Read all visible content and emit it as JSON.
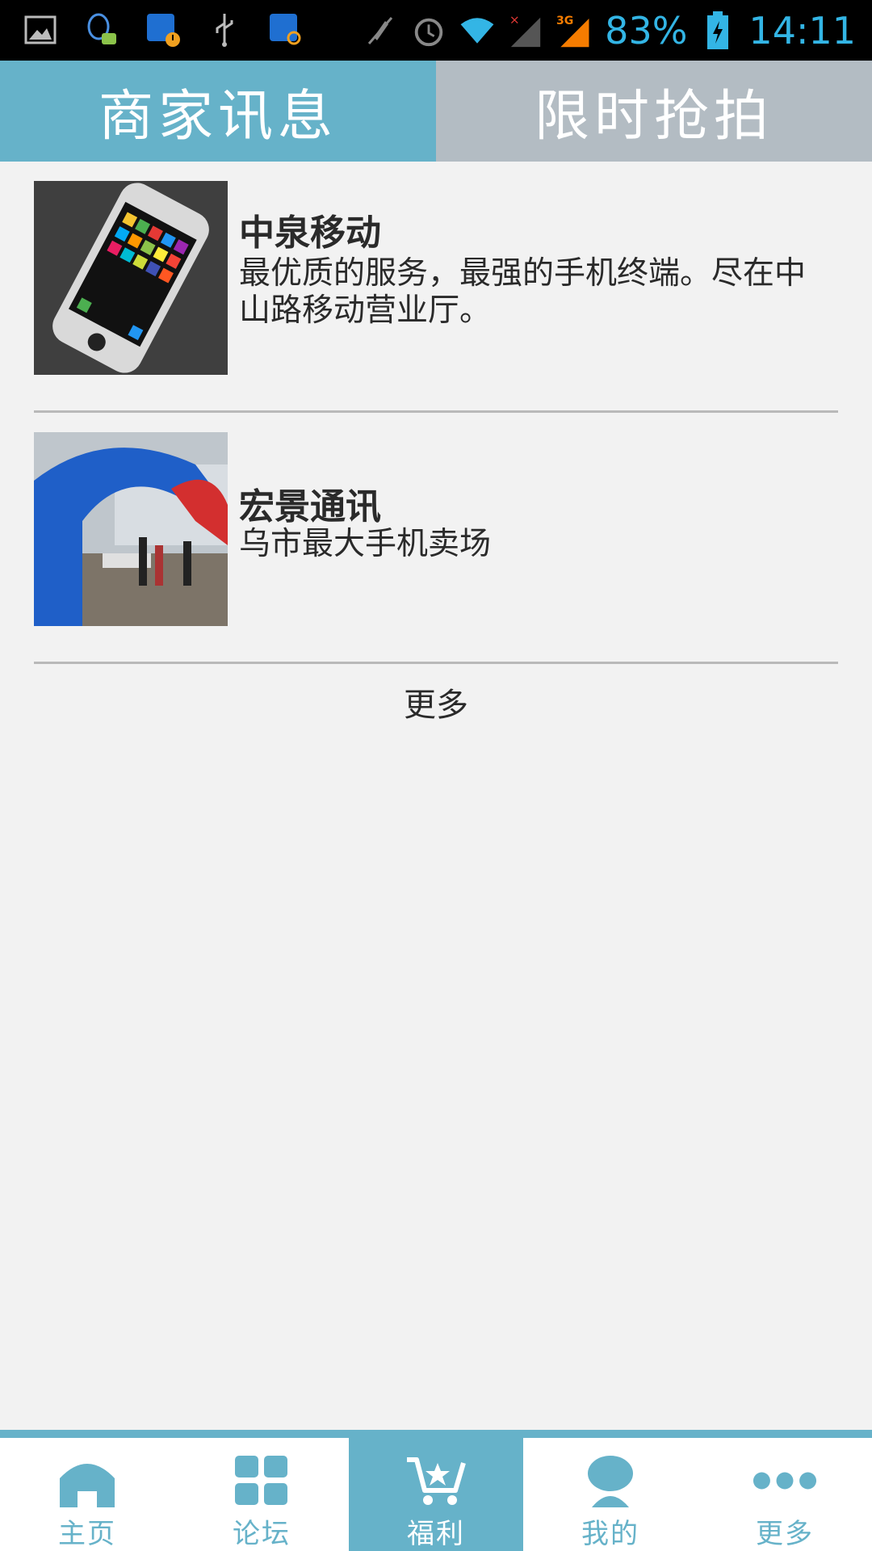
{
  "status_bar": {
    "battery_percent": "83%",
    "time": "14:11",
    "network": "3G",
    "accent_color": "#33b5e5",
    "left_icons": [
      "gallery-icon",
      "qq-notification-icon",
      "sync-warning-icon",
      "usb-icon",
      "sync-search-icon"
    ],
    "right_icons": [
      "vibrate-muted-icon",
      "alarm-icon",
      "wifi-icon",
      "signal-no-service-icon",
      "signal-3g-icon",
      "battery-charging-icon"
    ]
  },
  "tabs": [
    {
      "label": "商家讯息",
      "active": true
    },
    {
      "label": "限时抢拍",
      "active": false
    }
  ],
  "merchants": [
    {
      "title": "中泉移动",
      "description": "最优质的服务，最强的手机终端。尽在中山路移动营业厅。",
      "image": "phone-product-photo"
    },
    {
      "title": "宏景通讯",
      "description": "乌市最大手机卖场",
      "image": "store-event-arch-photo"
    }
  ],
  "more_label": "更多",
  "bottom_nav": [
    {
      "label": "主页",
      "icon": "home-icon",
      "active": false
    },
    {
      "label": "论坛",
      "icon": "grid-icon",
      "active": false
    },
    {
      "label": "福利",
      "icon": "cart-star-icon",
      "active": true
    },
    {
      "label": "我的",
      "icon": "user-icon",
      "active": false
    },
    {
      "label": "更多",
      "icon": "more-dots-icon",
      "active": false
    }
  ],
  "colors": {
    "primary": "#66b2c9",
    "inactive_tab": "#b3bcc3",
    "background": "#f2f2f2"
  }
}
